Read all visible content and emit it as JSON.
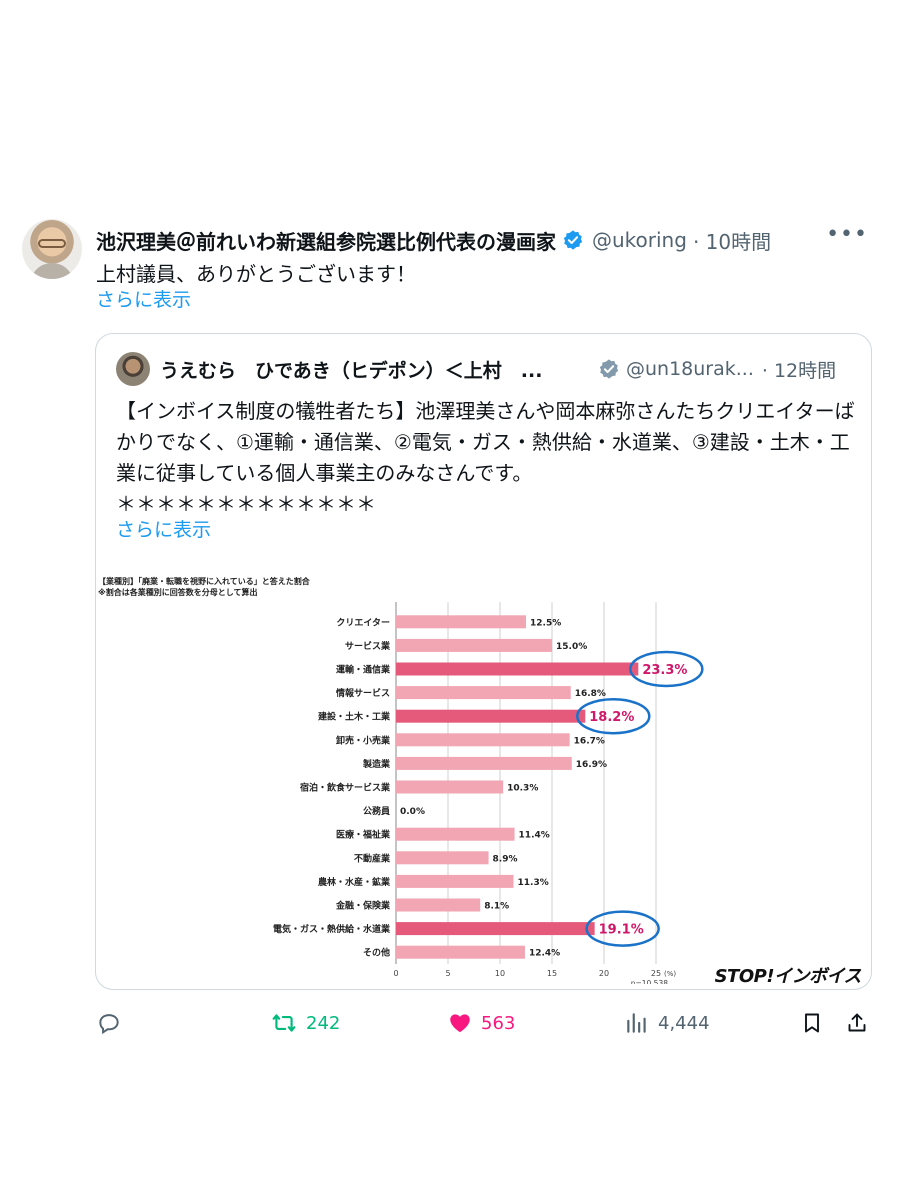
{
  "post": {
    "author_name": "池沢理美＠前れいわ新選組参院選比例代表の漫画家",
    "handle": "@ukoring",
    "time": "· 10時間",
    "more": "•••",
    "text": "上村議員、ありがとうございます！",
    "show_more": "さらに表示"
  },
  "quote": {
    "author_name": "うえむら　ひであき（ヒデポン）＜上村　...",
    "handle": "@un18urak...",
    "time": "· 12時間",
    "text": "【インボイス制度の犠牲者たち】池澤理美さんや岡本麻弥さんたちクリエイターばかりでなく、①運輸・通信業、②電気・ガス・熱供給・水道業、③建設・土木・工業に従事している個人事業主のみなさんです。\n＊＊＊＊＊＊＊＊＊＊＊＊＊",
    "show_more": "さらに表示"
  },
  "chart_data": {
    "type": "bar",
    "title": "【業種別】「廃業・転職を視野に入れている」と答えた割合",
    "subtitle": "※割合は各業種別に回答数を分母として算出",
    "categories": [
      "クリエイター",
      "サービス業",
      "運輸・通信業",
      "情報サービス",
      "建設・土木・工業",
      "卸売・小売業",
      "製造業",
      "宿泊・飲食サービス業",
      "公務員",
      "医療・福祉業",
      "不動産業",
      "農林・水産・鉱業",
      "金融・保険業",
      "電気・ガス・熱供給・水道業",
      "その他"
    ],
    "values": [
      12.5,
      15.0,
      23.3,
      16.8,
      18.2,
      16.7,
      16.9,
      10.3,
      0.0,
      11.4,
      8.9,
      11.3,
      8.1,
      19.1,
      12.4
    ],
    "value_labels": [
      "12.5%",
      "15.0%",
      "23.3%",
      "16.8%",
      "18.2%",
      "16.7%",
      "16.9%",
      "10.3%",
      "0.0%",
      "11.4%",
      "8.9%",
      "11.3%",
      "8.1%",
      "19.1%",
      "12.4%"
    ],
    "highlighted": [
      2,
      4,
      13
    ],
    "xlim": [
      0,
      25
    ],
    "xticks": [
      "0",
      "5",
      "10",
      "15",
      "20",
      "25"
    ],
    "xunit": "(%)",
    "note": "n=10,538",
    "colors": {
      "bar": "#f2a5b3",
      "highlight": "#e55a7a",
      "highlight_text": "#d0186a",
      "circle": "#1a73c8"
    }
  },
  "logo": "STOP!インボイス",
  "actions": {
    "reply_count": "",
    "retweet_count": "242",
    "like_count": "563",
    "view_count": "4,444"
  },
  "colors": {
    "link": "#1d9bf0",
    "verified": "#1d9bf0",
    "retweet": "#00ba7c",
    "like": "#f91880",
    "muted": "#536471"
  }
}
